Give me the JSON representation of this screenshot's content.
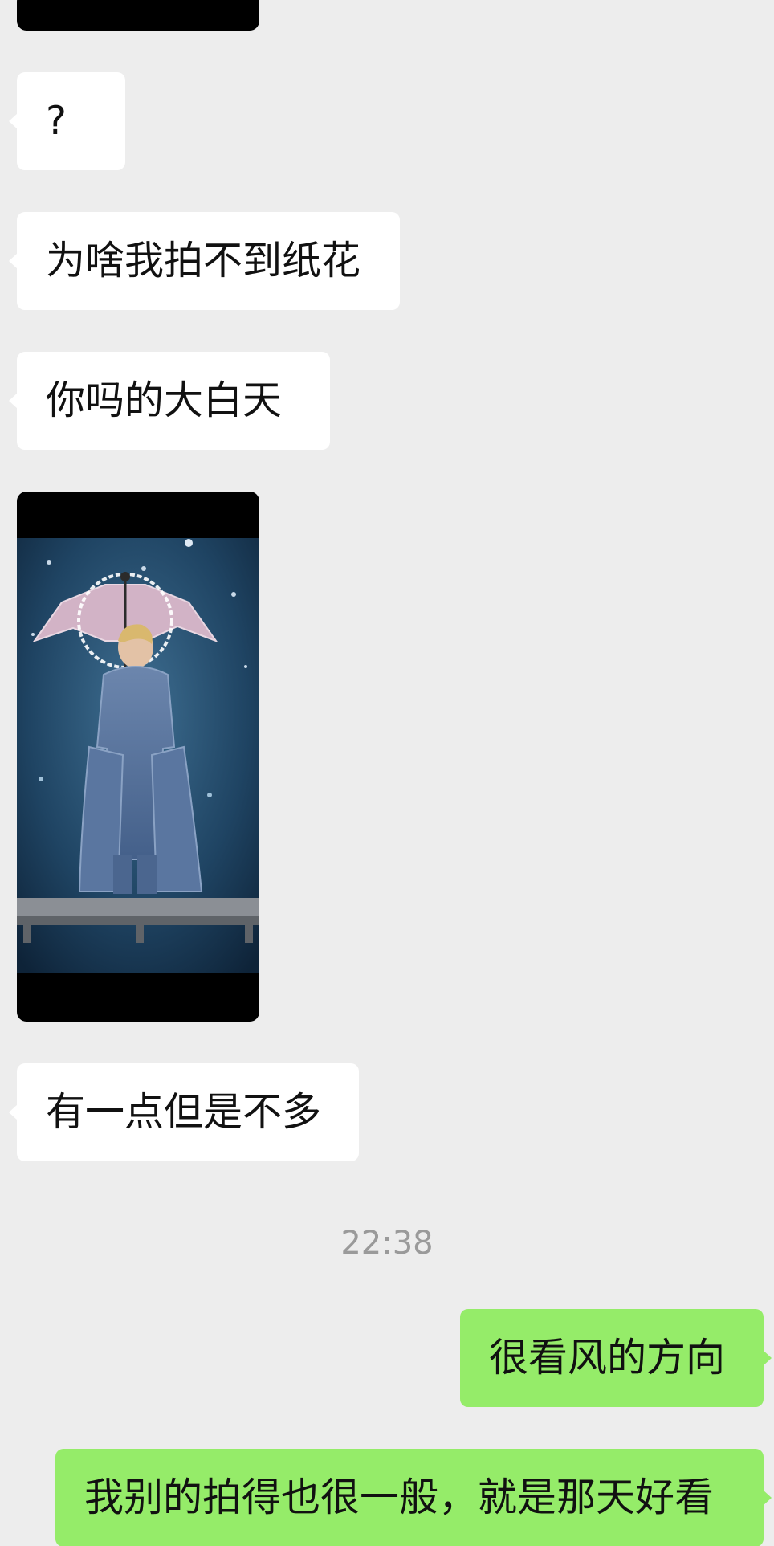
{
  "chat": {
    "messages": [
      {
        "side": "in",
        "text": "?"
      },
      {
        "side": "in",
        "text": "为啥我拍不到纸花"
      },
      {
        "side": "in",
        "text": "你吗的大白天"
      },
      {
        "side": "in",
        "text": "有一点但是不多"
      },
      {
        "side": "out",
        "text": "很看风的方向"
      },
      {
        "side": "out",
        "text": "我别的拍得也很一般，就是那天好看"
      }
    ],
    "timestamp": "22:38"
  },
  "colors": {
    "background": "#ededed",
    "incoming_bubble": "#ffffff",
    "outgoing_bubble": "#95ec69",
    "timestamp_text": "#9a9a9a"
  }
}
